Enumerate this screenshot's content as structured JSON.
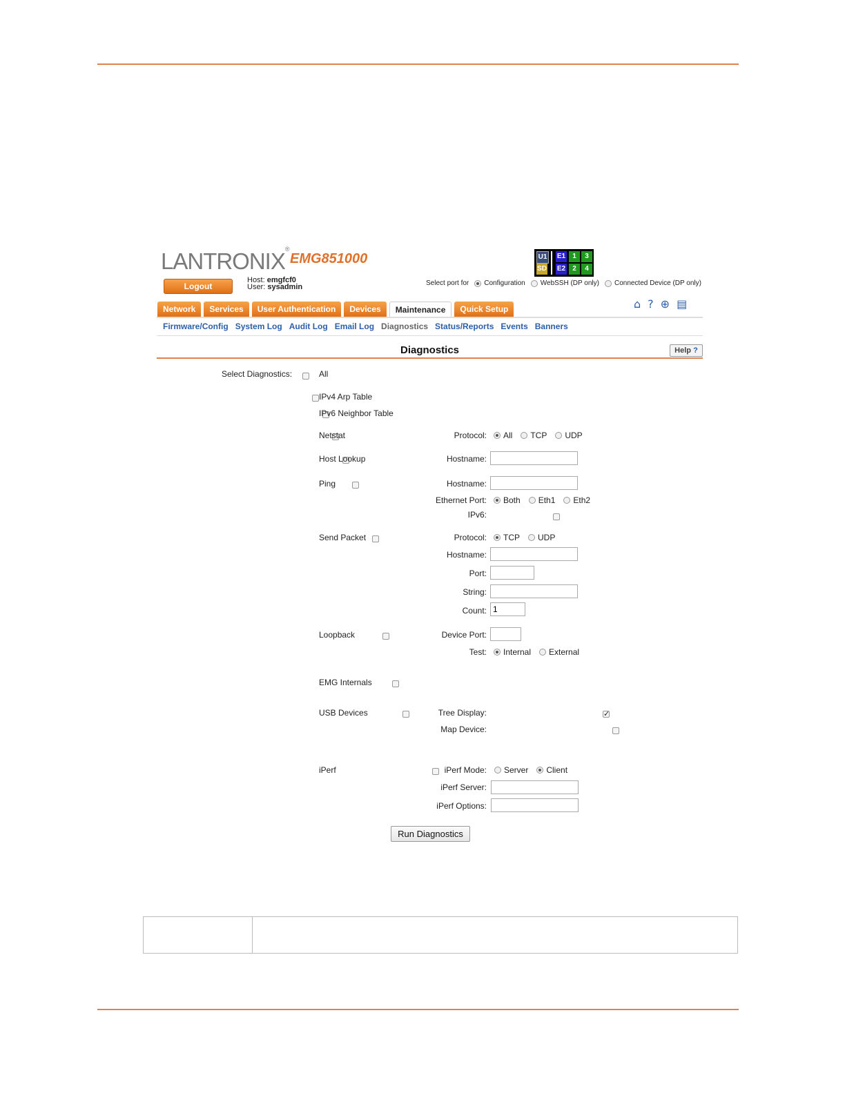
{
  "header": {
    "logo_text": "LANTRONIX",
    "logo_reg": "®",
    "model": "EMG851000",
    "logout_label": "Logout",
    "host_label": "Host:",
    "host_value": "emgfcf0",
    "user_label": "User:",
    "user_value": "sysadmin"
  },
  "port_status": {
    "cells": [
      {
        "label": "U1",
        "color": "#3a4d7a"
      },
      {
        "label": "SD",
        "color": "#c8a828"
      },
      {
        "label": "E1",
        "color": "#2a1fd0"
      },
      {
        "label": "E2",
        "color": "#2a1fd0"
      },
      {
        "label": "1",
        "color": "#1f9a1f"
      },
      {
        "label": "2",
        "color": "#1f9a1f"
      },
      {
        "label": "3",
        "color": "#1f9a1f"
      },
      {
        "label": "4",
        "color": "#1f9a1f"
      }
    ]
  },
  "port_select": {
    "label": "Select port for",
    "options": [
      "Configuration",
      "WebSSH (DP only)",
      "Connected Device (DP only)"
    ],
    "selected": "Configuration"
  },
  "tabs": [
    "Network",
    "Services",
    "User Authentication",
    "Devices",
    "Maintenance",
    "Quick Setup"
  ],
  "active_tab": "Maintenance",
  "toolbar_icons": [
    "home-icon",
    "help-icon",
    "network-icon",
    "log-icon"
  ],
  "subnav": [
    "Firmware/Config",
    "System Log",
    "Audit Log",
    "Email Log",
    "Diagnostics",
    "Status/Reports",
    "Events",
    "Banners"
  ],
  "active_subnav": "Diagnostics",
  "page": {
    "title": "Diagnostics",
    "help_label": "Help"
  },
  "form": {
    "select_label": "Select Diagnostics:",
    "all": "All",
    "ipv4_arp": "IPv4 Arp Table",
    "ipv6_neighbor": "IPv6 Neighbor Table",
    "netstat": {
      "label": "Netstat",
      "protocol_label": "Protocol:",
      "options": [
        "All",
        "TCP",
        "UDP"
      ],
      "selected": "All"
    },
    "host_lookup": {
      "label": "Host Lookup",
      "hostname_label": "Hostname:",
      "hostname_value": ""
    },
    "ping": {
      "label": "Ping",
      "hostname_label": "Hostname:",
      "hostname_value": "",
      "eth_label": "Ethernet Port:",
      "eth_options": [
        "Both",
        "Eth1",
        "Eth2"
      ],
      "eth_selected": "Both",
      "ipv6_label": "IPv6:"
    },
    "send_packet": {
      "label": "Send Packet",
      "protocol_label": "Protocol:",
      "options": [
        "TCP",
        "UDP"
      ],
      "selected": "TCP",
      "hostname_label": "Hostname:",
      "port_label": "Port:",
      "string_label": "String:",
      "count_label": "Count:",
      "count_value": "1"
    },
    "loopback": {
      "label": "Loopback",
      "device_port_label": "Device Port:",
      "test_label": "Test:",
      "test_options": [
        "Internal",
        "External"
      ],
      "test_selected": "Internal"
    },
    "emg_internals": "EMG Internals",
    "usb_devices": {
      "label": "USB Devices",
      "tree_label": "Tree Display:",
      "tree_checked": true,
      "map_label": "Map Device:"
    },
    "iperf": {
      "label": "iPerf",
      "mode_label": "iPerf Mode:",
      "mode_options": [
        "Server",
        "Client"
      ],
      "mode_selected": "Client",
      "server_label": "iPerf Server:",
      "options_label": "iPerf Options:"
    },
    "run_label": "Run Diagnostics"
  }
}
